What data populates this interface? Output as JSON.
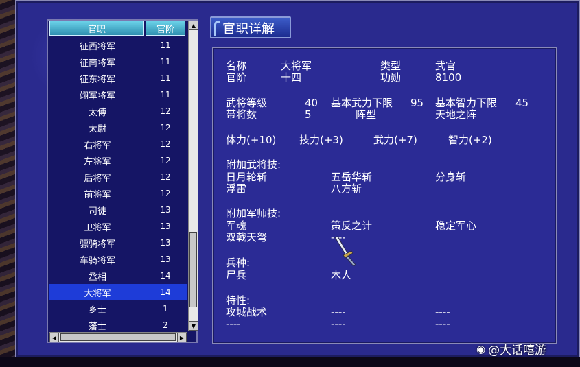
{
  "list": {
    "header_name": "官职",
    "header_rank": "官阶",
    "rows": [
      {
        "name": "征西将军",
        "rank": "11"
      },
      {
        "name": "征南将军",
        "rank": "11"
      },
      {
        "name": "征东将军",
        "rank": "11"
      },
      {
        "name": "翊军将军",
        "rank": "11"
      },
      {
        "name": "太傅",
        "rank": "12"
      },
      {
        "name": "太尉",
        "rank": "12"
      },
      {
        "name": "右将军",
        "rank": "12"
      },
      {
        "name": "左将军",
        "rank": "12"
      },
      {
        "name": "后将军",
        "rank": "12"
      },
      {
        "name": "前将军",
        "rank": "12"
      },
      {
        "name": "司徒",
        "rank": "13"
      },
      {
        "name": "卫将军",
        "rank": "13"
      },
      {
        "name": "骠骑将军",
        "rank": "13"
      },
      {
        "name": "车骑将军",
        "rank": "13"
      },
      {
        "name": "丞相",
        "rank": "14"
      },
      {
        "name": "大将军",
        "rank": "14"
      },
      {
        "name": "乡士",
        "rank": "1"
      },
      {
        "name": "藩士",
        "rank": "2"
      }
    ],
    "selected_index": 15
  },
  "detail": {
    "title": "官职详解",
    "name_label": "名称",
    "name_value": "大将军",
    "type_label": "类型",
    "type_value": "武官",
    "rank_label": "官阶",
    "rank_value": "十四",
    "merit_label": "功勋",
    "merit_value": "8100",
    "level_label": "武将等级",
    "level_value": "40",
    "min_force_label": "基本武力下限",
    "min_force_value": "95",
    "min_intel_label": "基本智力下限",
    "min_intel_value": "45",
    "generals_label": "带将数",
    "generals_value": "5",
    "formation_label": "阵型",
    "formation_value": "天地之阵",
    "bonus_hp": "体力(+10)",
    "bonus_skill": "技力(+3)",
    "bonus_force": "武力(+7)",
    "bonus_intel": "智力(+2)",
    "general_skills_label": "附加武将技:",
    "general_skills": [
      "日月轮斩",
      "五岳华斩",
      "分身斩",
      "浮雷",
      "八方斩"
    ],
    "strategist_skills_label": "附加军师技:",
    "strategist_skills": [
      "军魂",
      "策反之计",
      "稳定军心",
      "双戟天弩",
      "----"
    ],
    "troops_label": "兵种:",
    "troops": [
      "尸兵",
      "木人"
    ],
    "traits_label": "特性:",
    "traits": [
      "攻城战术",
      "----",
      "----",
      "----",
      "----",
      "----"
    ]
  },
  "watermark": {
    "icon": "weibo-icon",
    "text": "@大话嘻游"
  }
}
